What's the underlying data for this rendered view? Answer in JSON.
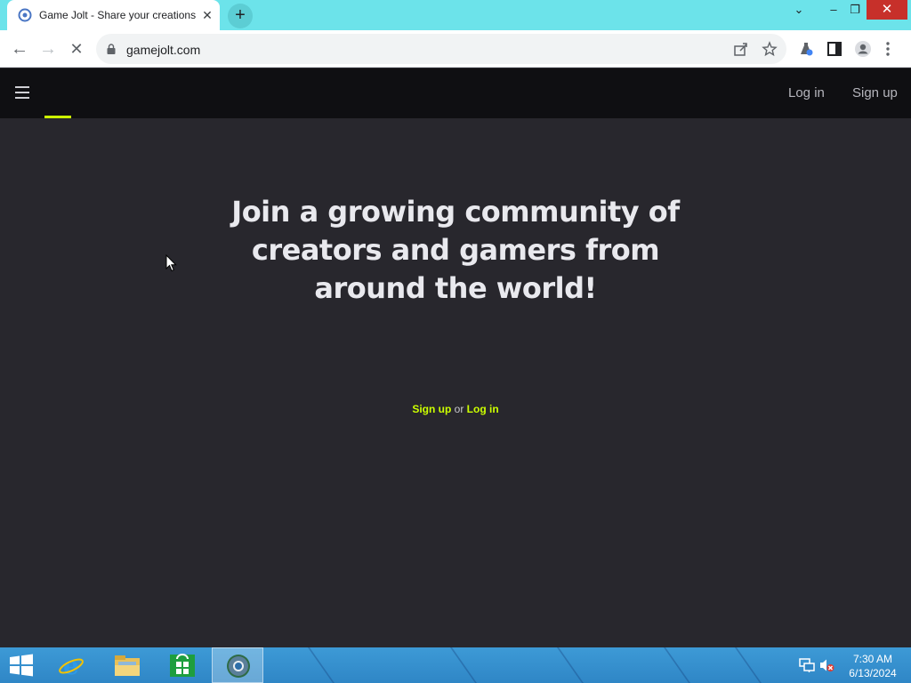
{
  "browser": {
    "tab_title": "Game Jolt - Share your creations",
    "tab_close": "✕",
    "new_tab": "+",
    "url": "gamejolt.com",
    "window_controls": {
      "tab_search": "⌄",
      "minimize": "–",
      "restore": "❐",
      "close": "✕"
    },
    "nav": {
      "back": "←",
      "forward": "→",
      "stop": "✕"
    }
  },
  "site_header": {
    "login_label": "Log in",
    "signup_label": "Sign up",
    "accent_color": "#ccff00"
  },
  "hero": {
    "heading": "Join a growing community of creators and gamers from around the world!",
    "cta_signup": "Sign up",
    "cta_or": "or",
    "cta_login": "Log in"
  },
  "taskbar": {
    "time": "7:30 AM",
    "date": "6/13/2024",
    "apps": [
      "internet-explorer",
      "file-explorer",
      "store",
      "chrome"
    ]
  },
  "colors": {
    "tabbar": "#6ce3ea",
    "page_bg": "#28272d",
    "header_bg": "#0f0f12",
    "highlight": "#ccff00"
  }
}
